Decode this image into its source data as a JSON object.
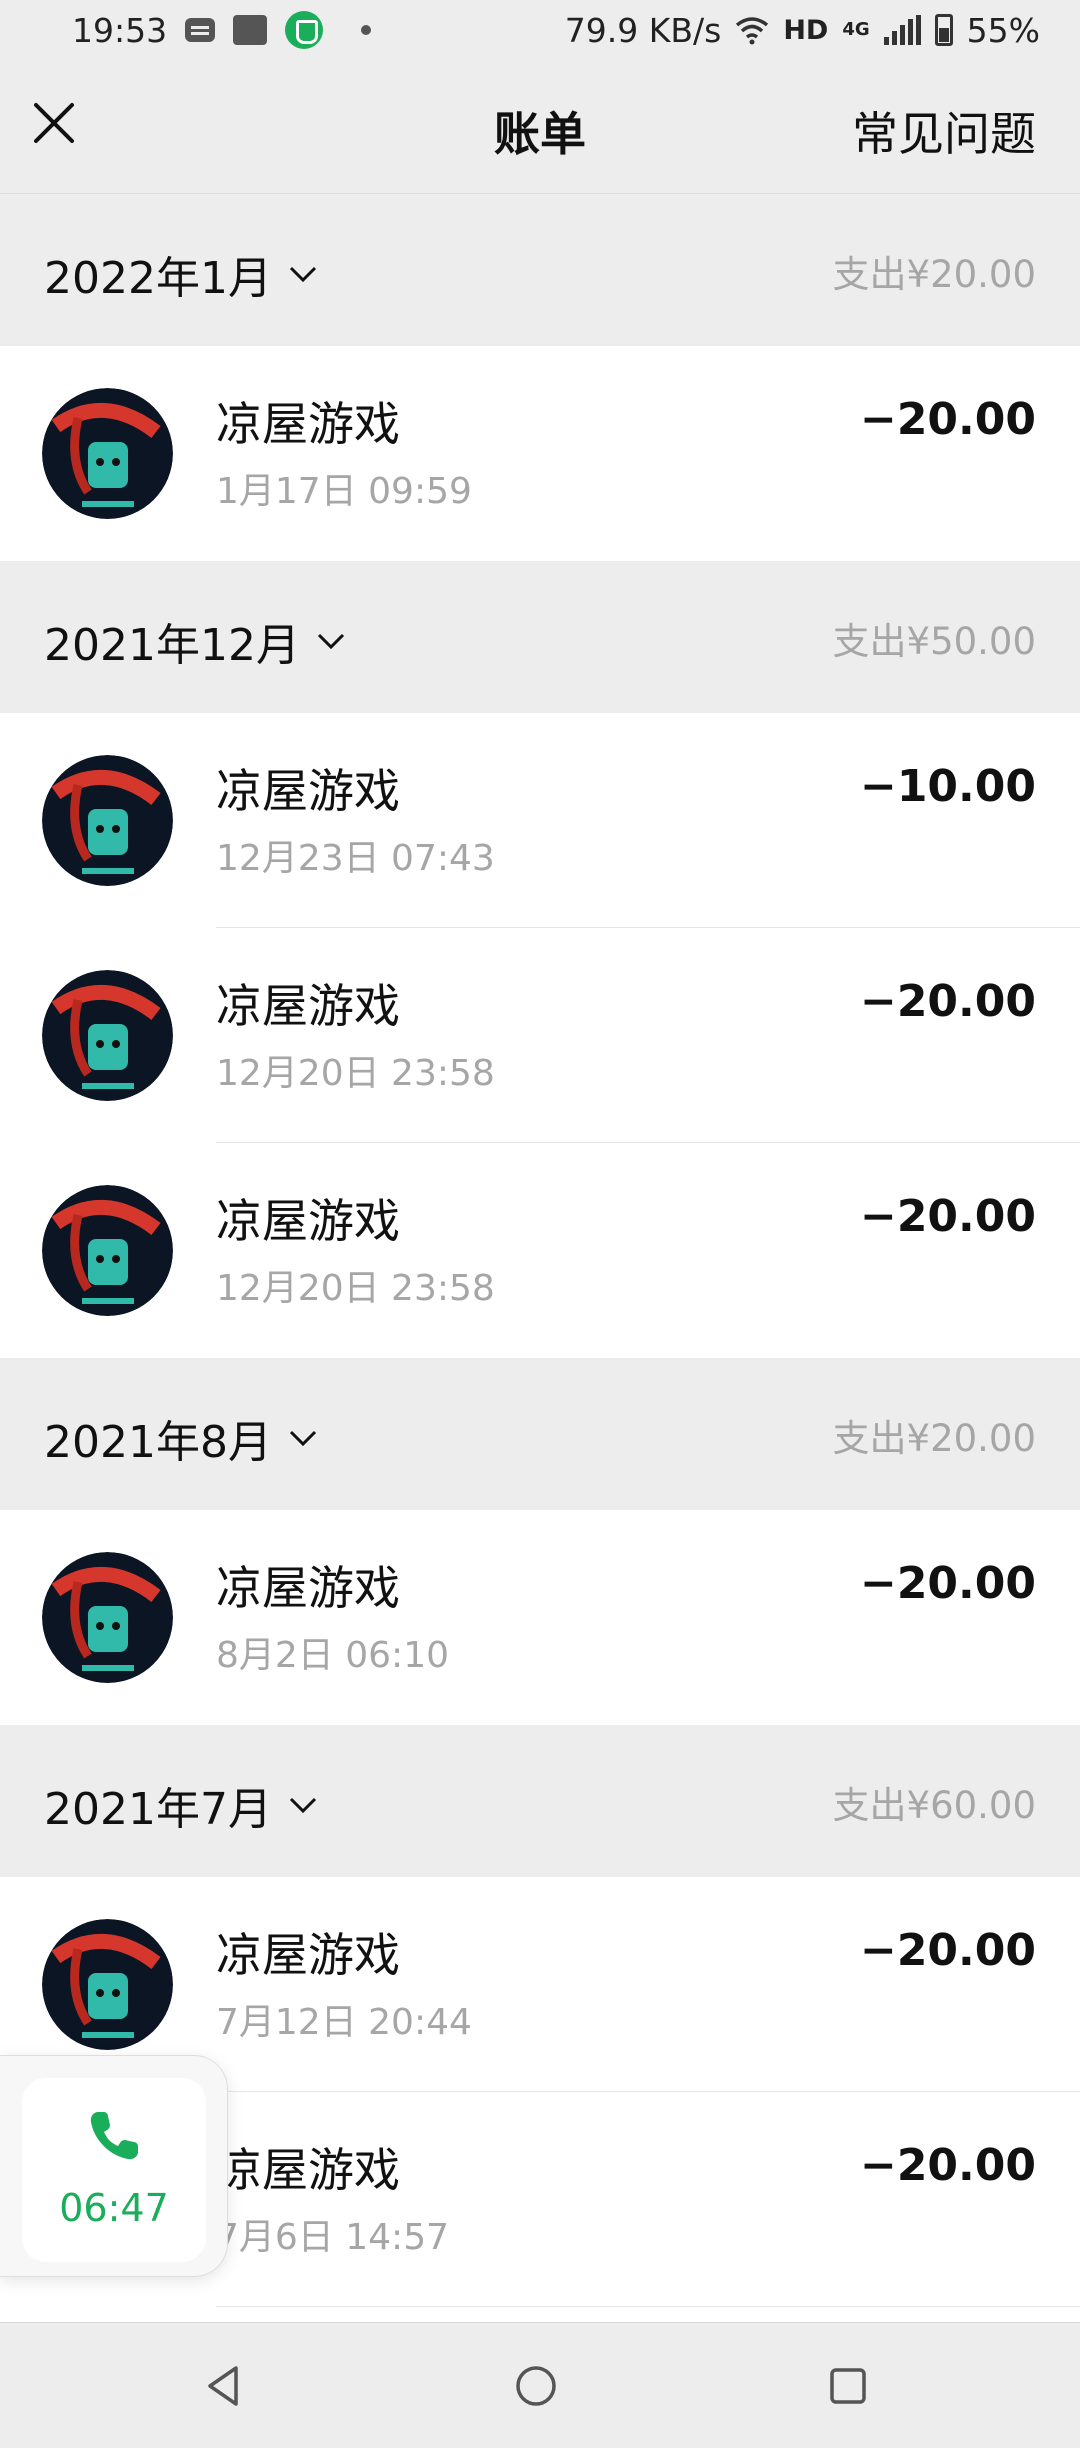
{
  "status_bar": {
    "time": "19:53",
    "net_speed": "79.9 KB/s",
    "hd": "HD",
    "network": "4G",
    "battery": "55%"
  },
  "header": {
    "title": "账单",
    "faq": "常见问题"
  },
  "months": [
    {
      "label": "2022年1月",
      "total": "支出¥20.00",
      "items": [
        {
          "name": "凉屋游戏",
          "date": "1月17日 09:59",
          "amount": "−20.00"
        }
      ]
    },
    {
      "label": "2021年12月",
      "total": "支出¥50.00",
      "items": [
        {
          "name": "凉屋游戏",
          "date": "12月23日 07:43",
          "amount": "−10.00"
        },
        {
          "name": "凉屋游戏",
          "date": "12月20日 23:58",
          "amount": "−20.00"
        },
        {
          "name": "凉屋游戏",
          "date": "12月20日 23:58",
          "amount": "−20.00"
        }
      ]
    },
    {
      "label": "2021年8月",
      "total": "支出¥20.00",
      "items": [
        {
          "name": "凉屋游戏",
          "date": "8月2日 06:10",
          "amount": "−20.00"
        }
      ]
    },
    {
      "label": "2021年7月",
      "total": "支出¥60.00",
      "items": [
        {
          "name": "凉屋游戏",
          "date": "7月12日 20:44",
          "amount": "−20.00"
        },
        {
          "name": "凉屋游戏",
          "date": "7月6日 14:57",
          "amount": "−20.00"
        }
      ]
    }
  ],
  "call_float": {
    "duration": "06:47"
  },
  "icons": {
    "close": "close-icon",
    "chevron": "chevron-down-icon",
    "call": "phone-icon",
    "nav_back": "triangle-back-icon",
    "nav_home": "circle-home-icon",
    "nav_recents": "square-recents-icon"
  },
  "colors": {
    "header_bg": "#ededed",
    "accent_green": "#1aad5a",
    "muted_text": "#a6a6a6"
  }
}
